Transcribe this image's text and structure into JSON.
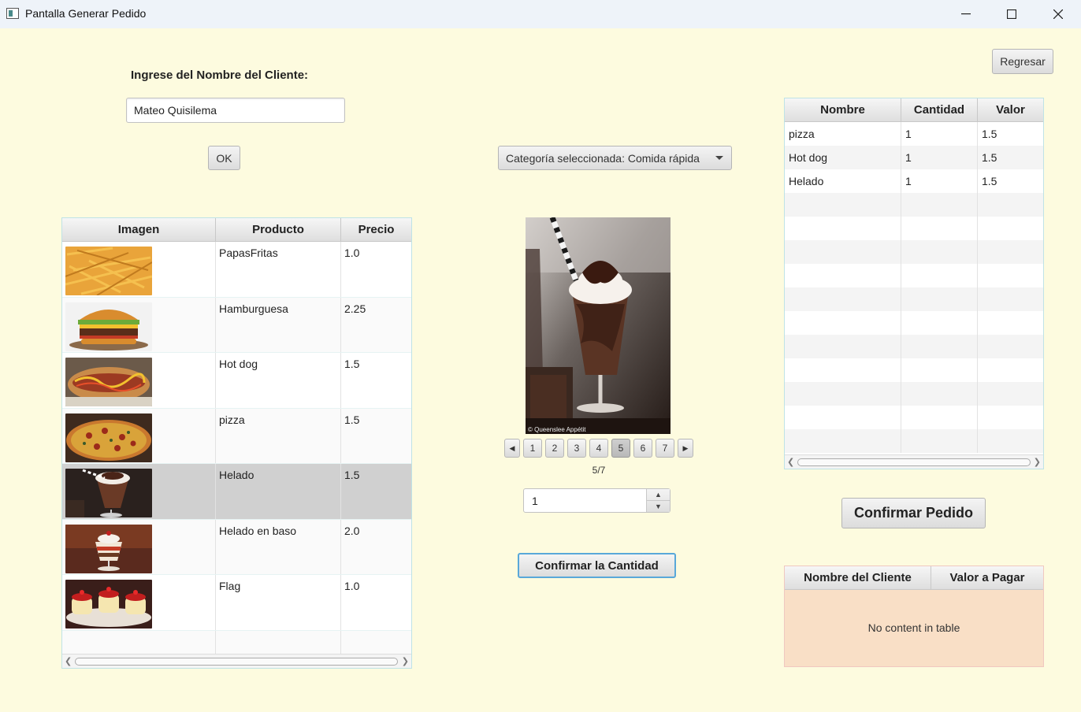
{
  "window": {
    "title": "Pantalla Generar Pedido"
  },
  "client": {
    "label": "Ingrese del Nombre del Cliente:",
    "name_value": "Mateo Quisilema",
    "ok_label": "OK"
  },
  "back_button": "Regresar",
  "category": {
    "selected_label": "Categoría seleccionada: Comida rápida"
  },
  "products": {
    "columns": [
      "Imagen",
      "Producto",
      "Precio"
    ],
    "rows": [
      {
        "name": "PapasFritas",
        "price": "1.0",
        "image": "fries-image"
      },
      {
        "name": "Hamburguesa",
        "price": "2.25",
        "image": "burger-image"
      },
      {
        "name": "Hot dog",
        "price": "1.5",
        "image": "hotdog-image"
      },
      {
        "name": "pizza",
        "price": "1.5",
        "image": "pizza-image"
      },
      {
        "name": "Helado",
        "price": "1.5",
        "image": "icecream-image"
      },
      {
        "name": "Helado en baso",
        "price": "2.0",
        "image": "sundae-image"
      },
      {
        "name": "Flag",
        "price": "1.0",
        "image": "flan-image"
      }
    ],
    "selected_index": 4
  },
  "preview": {
    "watermark": "© Queenslee Appétit",
    "pages": [
      "1",
      "2",
      "3",
      "4",
      "5",
      "6",
      "7"
    ],
    "current_page": 5,
    "page_indicator": "5/7"
  },
  "quantity": {
    "value": "1",
    "confirm_label": "Confirmar la Cantidad"
  },
  "order": {
    "columns": [
      "Nombre",
      "Cantidad",
      "Valor"
    ],
    "rows": [
      {
        "name": "pizza",
        "qty": "1",
        "value": "1.5"
      },
      {
        "name": "Hot dog",
        "qty": "1",
        "value": "1.5"
      },
      {
        "name": "Helado",
        "qty": "1",
        "value": "1.5"
      }
    ],
    "confirm_label": "Confirmar Pedido"
  },
  "summary": {
    "columns": [
      "Nombre del Cliente",
      "Valor a Pagar"
    ],
    "empty_text": "No content in table"
  }
}
